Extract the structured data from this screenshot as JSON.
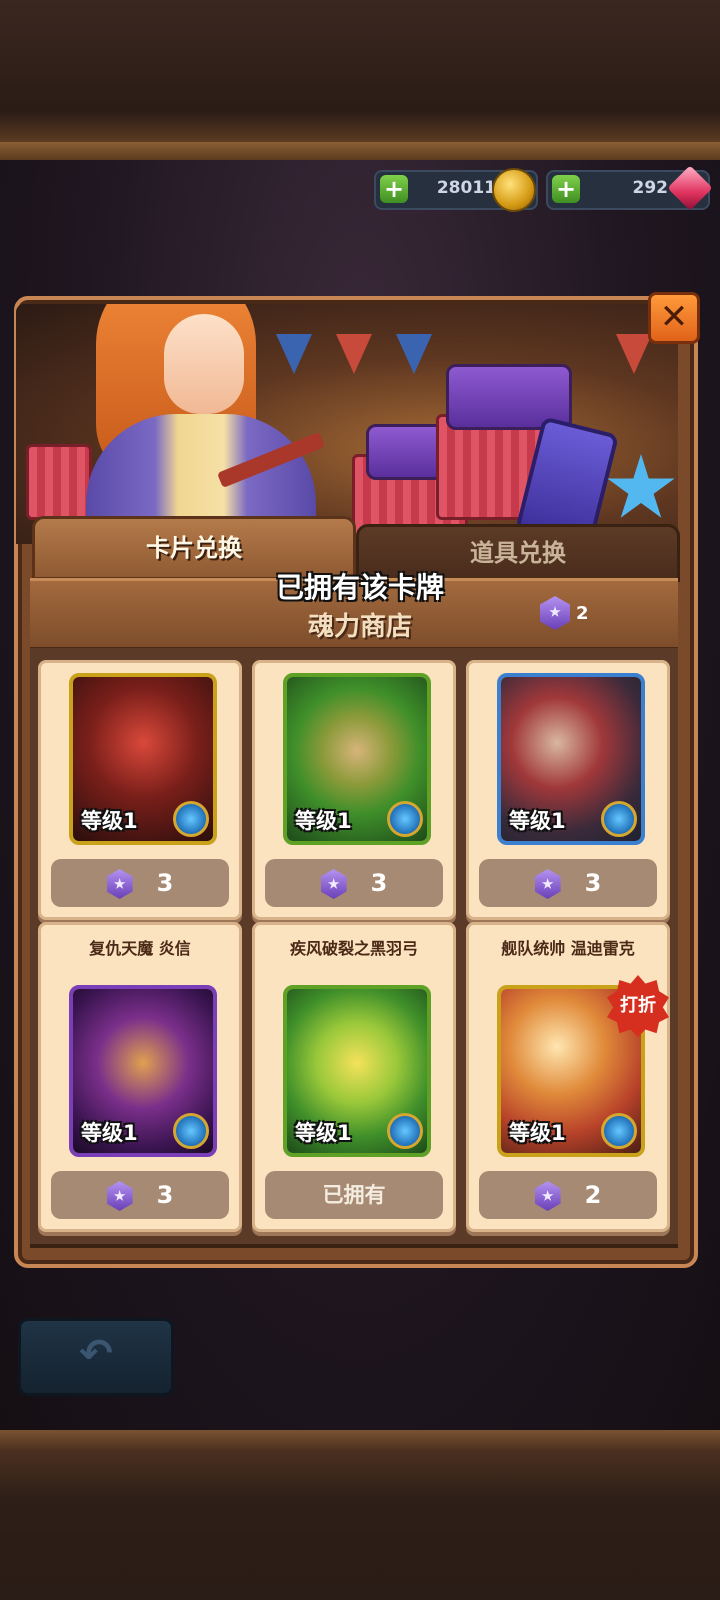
{
  "currency": {
    "gold": "28011",
    "gems": "292",
    "plus_label": "+"
  },
  "close_label": "✕",
  "tabs": [
    {
      "label": "卡片兑换",
      "active": true
    },
    {
      "label": "道具兑换",
      "active": false
    }
  ],
  "toast": "已拥有该卡牌",
  "shop": {
    "title": "魂力商店",
    "soul_balance": "2"
  },
  "items": [
    {
      "name": "",
      "level": "等级1",
      "price": "3",
      "owned": false,
      "frame": "#c9a21a",
      "art": "warrior-dark"
    },
    {
      "name": "",
      "level": "等级1",
      "price": "3",
      "owned": false,
      "frame": "#5ea124",
      "art": "seed-pod"
    },
    {
      "name": "",
      "level": "等级1",
      "price": "3",
      "owned": false,
      "frame": "#3b7fd0",
      "art": "mage-red"
    },
    {
      "name": "复仇天魔 炎信",
      "level": "等级1",
      "price": "3",
      "owned": false,
      "frame": "#7a3fb8",
      "art": "demon-purple"
    },
    {
      "name": "疾风破裂之黑羽弓",
      "level": "等级1",
      "price": "已拥有",
      "owned": true,
      "frame": "#5ea124",
      "art": "black-bow"
    },
    {
      "name": "舰队统帅 温迪雷克",
      "level": "等级1",
      "price": "2",
      "owned": false,
      "frame": "#c9a21a",
      "art": "admiral",
      "badge": "打折"
    }
  ],
  "back_label": "↶"
}
